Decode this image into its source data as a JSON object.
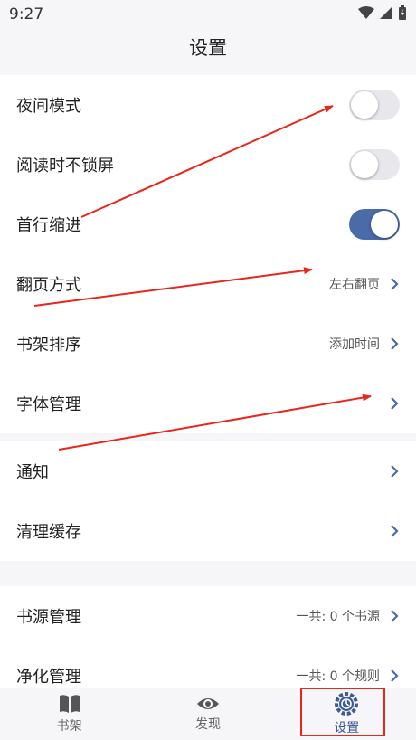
{
  "status": {
    "time": "9:27"
  },
  "title": "设置",
  "sections": [
    {
      "rows": [
        {
          "label": "夜间模式",
          "type": "toggle",
          "on": false
        },
        {
          "label": "阅读时不锁屏",
          "type": "toggle",
          "on": false
        },
        {
          "label": "首行缩进",
          "type": "toggle",
          "on": true
        },
        {
          "label": "翻页方式",
          "type": "link",
          "value": "左右翻页"
        },
        {
          "label": "书架排序",
          "type": "link",
          "value": "添加时间"
        },
        {
          "label": "字体管理",
          "type": "link",
          "value": ""
        }
      ]
    },
    {
      "rows": [
        {
          "label": "通知",
          "type": "link",
          "value": ""
        },
        {
          "label": "清理缓存",
          "type": "link",
          "value": ""
        }
      ]
    },
    {
      "rows": [
        {
          "label": "书源管理",
          "type": "link",
          "value": "一共: 0 个书源"
        },
        {
          "label": "净化管理",
          "type": "link",
          "value": "一共: 0 个规则"
        }
      ]
    }
  ],
  "tabs": [
    {
      "label": "书架",
      "icon": "book-icon",
      "active": false
    },
    {
      "label": "发现",
      "icon": "eye-icon",
      "active": false
    },
    {
      "label": "设置",
      "icon": "settings-icon",
      "active": true
    }
  ],
  "colors": {
    "accent": "#4b6aa8",
    "annotation": "#e8261d"
  }
}
